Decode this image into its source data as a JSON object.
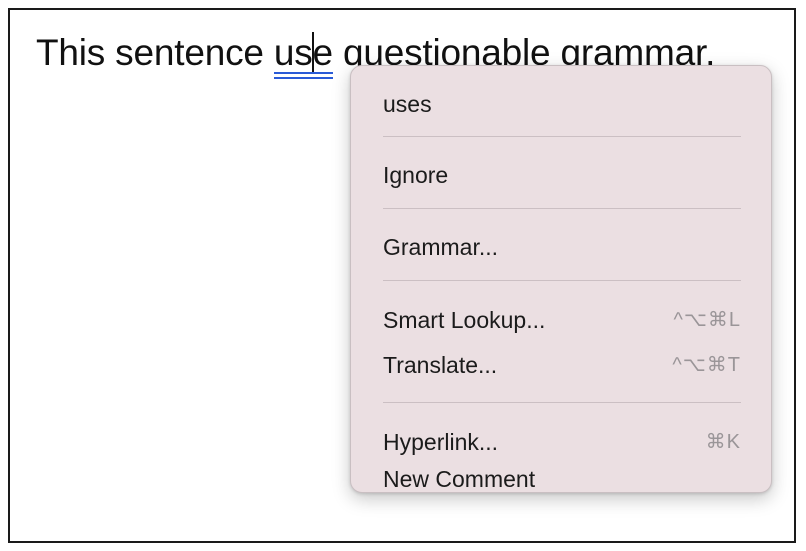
{
  "document": {
    "text_before": "This sentence ",
    "flagged_word_part1": "us",
    "flagged_word_part2": "e",
    "text_after": " questionable grammar."
  },
  "context_menu": {
    "suggestion": "uses",
    "ignore": "Ignore",
    "grammar": "Grammar...",
    "smart_lookup": {
      "label": "Smart Lookup...",
      "shortcut": "^⌥⌘L"
    },
    "translate": {
      "label": "Translate...",
      "shortcut": "^⌥⌘T"
    },
    "hyperlink": {
      "label": "Hyperlink...",
      "shortcut": "⌘K"
    },
    "new_comment": "New Comment"
  },
  "colors": {
    "menu_background": "#ebdfe2",
    "grammar_underline": "#2a5bd7",
    "shortcut_text": "#9a9598"
  }
}
